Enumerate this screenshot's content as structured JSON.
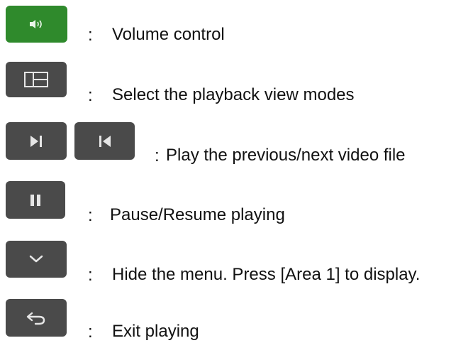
{
  "legend": {
    "items": [
      {
        "icon": "volume-icon",
        "separator": ":",
        "description": "Volume control"
      },
      {
        "icon": "view-modes-icon",
        "separator": ":",
        "description": "Select the playback view modes"
      },
      {
        "icon": "next-previous-icon",
        "separator": ":",
        "description": "Play the previous/next video file"
      },
      {
        "icon": "pause-icon",
        "separator": ":",
        "description": "Pause/Resume playing"
      },
      {
        "icon": "chevron-down-icon",
        "separator": ":",
        "description": "Hide the menu. Press [Area 1] to display."
      },
      {
        "icon": "return-icon",
        "separator": ":",
        "description": "Exit playing"
      }
    ]
  },
  "colors": {
    "button_gray": "#4a4a4a",
    "button_green": "#2f8a2c",
    "icon_fill": "#e6e6e6"
  }
}
